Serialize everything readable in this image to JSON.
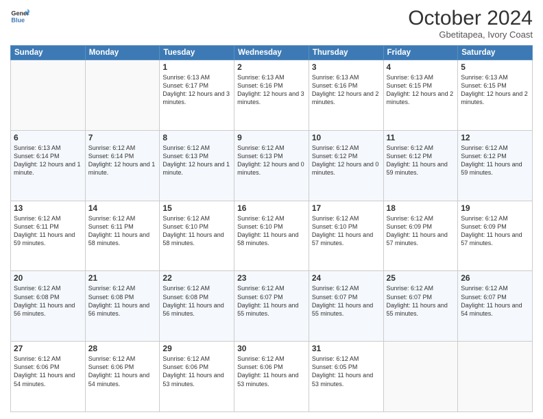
{
  "logo": {
    "line1": "General",
    "line2": "Blue"
  },
  "title": "October 2024",
  "subtitle": "Gbetitapea, Ivory Coast",
  "weekdays": [
    "Sunday",
    "Monday",
    "Tuesday",
    "Wednesday",
    "Thursday",
    "Friday",
    "Saturday"
  ],
  "weeks": [
    [
      {
        "day": "",
        "text": ""
      },
      {
        "day": "",
        "text": ""
      },
      {
        "day": "1",
        "text": "Sunrise: 6:13 AM\nSunset: 6:17 PM\nDaylight: 12 hours and 3 minutes."
      },
      {
        "day": "2",
        "text": "Sunrise: 6:13 AM\nSunset: 6:16 PM\nDaylight: 12 hours and 3 minutes."
      },
      {
        "day": "3",
        "text": "Sunrise: 6:13 AM\nSunset: 6:16 PM\nDaylight: 12 hours and 2 minutes."
      },
      {
        "day": "4",
        "text": "Sunrise: 6:13 AM\nSunset: 6:15 PM\nDaylight: 12 hours and 2 minutes."
      },
      {
        "day": "5",
        "text": "Sunrise: 6:13 AM\nSunset: 6:15 PM\nDaylight: 12 hours and 2 minutes."
      }
    ],
    [
      {
        "day": "6",
        "text": "Sunrise: 6:13 AM\nSunset: 6:14 PM\nDaylight: 12 hours and 1 minute."
      },
      {
        "day": "7",
        "text": "Sunrise: 6:12 AM\nSunset: 6:14 PM\nDaylight: 12 hours and 1 minute."
      },
      {
        "day": "8",
        "text": "Sunrise: 6:12 AM\nSunset: 6:13 PM\nDaylight: 12 hours and 1 minute."
      },
      {
        "day": "9",
        "text": "Sunrise: 6:12 AM\nSunset: 6:13 PM\nDaylight: 12 hours and 0 minutes."
      },
      {
        "day": "10",
        "text": "Sunrise: 6:12 AM\nSunset: 6:12 PM\nDaylight: 12 hours and 0 minutes."
      },
      {
        "day": "11",
        "text": "Sunrise: 6:12 AM\nSunset: 6:12 PM\nDaylight: 11 hours and 59 minutes."
      },
      {
        "day": "12",
        "text": "Sunrise: 6:12 AM\nSunset: 6:12 PM\nDaylight: 11 hours and 59 minutes."
      }
    ],
    [
      {
        "day": "13",
        "text": "Sunrise: 6:12 AM\nSunset: 6:11 PM\nDaylight: 11 hours and 59 minutes."
      },
      {
        "day": "14",
        "text": "Sunrise: 6:12 AM\nSunset: 6:11 PM\nDaylight: 11 hours and 58 minutes."
      },
      {
        "day": "15",
        "text": "Sunrise: 6:12 AM\nSunset: 6:10 PM\nDaylight: 11 hours and 58 minutes."
      },
      {
        "day": "16",
        "text": "Sunrise: 6:12 AM\nSunset: 6:10 PM\nDaylight: 11 hours and 58 minutes."
      },
      {
        "day": "17",
        "text": "Sunrise: 6:12 AM\nSunset: 6:10 PM\nDaylight: 11 hours and 57 minutes."
      },
      {
        "day": "18",
        "text": "Sunrise: 6:12 AM\nSunset: 6:09 PM\nDaylight: 11 hours and 57 minutes."
      },
      {
        "day": "19",
        "text": "Sunrise: 6:12 AM\nSunset: 6:09 PM\nDaylight: 11 hours and 57 minutes."
      }
    ],
    [
      {
        "day": "20",
        "text": "Sunrise: 6:12 AM\nSunset: 6:08 PM\nDaylight: 11 hours and 56 minutes."
      },
      {
        "day": "21",
        "text": "Sunrise: 6:12 AM\nSunset: 6:08 PM\nDaylight: 11 hours and 56 minutes."
      },
      {
        "day": "22",
        "text": "Sunrise: 6:12 AM\nSunset: 6:08 PM\nDaylight: 11 hours and 56 minutes."
      },
      {
        "day": "23",
        "text": "Sunrise: 6:12 AM\nSunset: 6:07 PM\nDaylight: 11 hours and 55 minutes."
      },
      {
        "day": "24",
        "text": "Sunrise: 6:12 AM\nSunset: 6:07 PM\nDaylight: 11 hours and 55 minutes."
      },
      {
        "day": "25",
        "text": "Sunrise: 6:12 AM\nSunset: 6:07 PM\nDaylight: 11 hours and 55 minutes."
      },
      {
        "day": "26",
        "text": "Sunrise: 6:12 AM\nSunset: 6:07 PM\nDaylight: 11 hours and 54 minutes."
      }
    ],
    [
      {
        "day": "27",
        "text": "Sunrise: 6:12 AM\nSunset: 6:06 PM\nDaylight: 11 hours and 54 minutes."
      },
      {
        "day": "28",
        "text": "Sunrise: 6:12 AM\nSunset: 6:06 PM\nDaylight: 11 hours and 54 minutes."
      },
      {
        "day": "29",
        "text": "Sunrise: 6:12 AM\nSunset: 6:06 PM\nDaylight: 11 hours and 53 minutes."
      },
      {
        "day": "30",
        "text": "Sunrise: 6:12 AM\nSunset: 6:06 PM\nDaylight: 11 hours and 53 minutes."
      },
      {
        "day": "31",
        "text": "Sunrise: 6:12 AM\nSunset: 6:05 PM\nDaylight: 11 hours and 53 minutes."
      },
      {
        "day": "",
        "text": ""
      },
      {
        "day": "",
        "text": ""
      }
    ]
  ]
}
